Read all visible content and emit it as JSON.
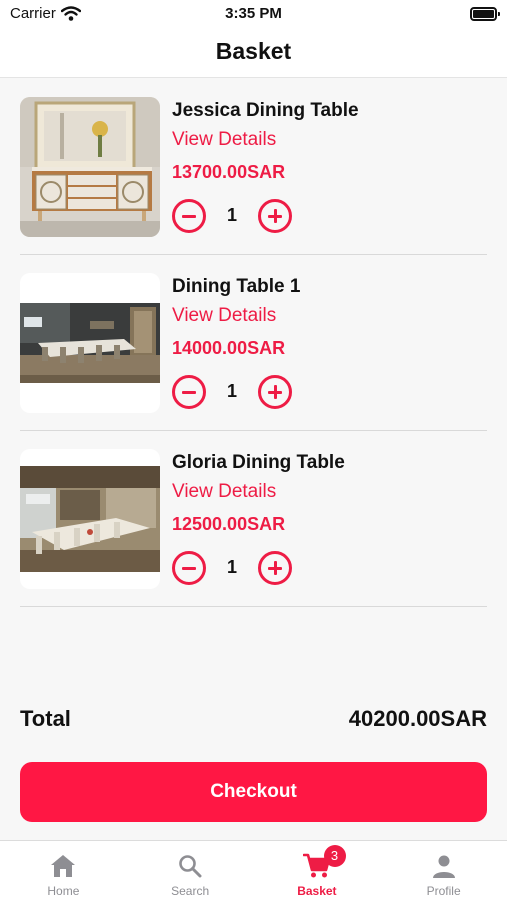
{
  "status_bar": {
    "carrier": "Carrier",
    "time": "3:35 PM"
  },
  "header": {
    "title": "Basket"
  },
  "items": [
    {
      "name": "Jessica Dining Table",
      "details_label": "View Details",
      "price": "13700.00SAR",
      "quantity": "1"
    },
    {
      "name": "Dining Table 1",
      "details_label": "View Details",
      "price": "14000.00SAR",
      "quantity": "1"
    },
    {
      "name": "Gloria Dining Table",
      "details_label": "View Details",
      "price": "12500.00SAR",
      "quantity": "1"
    }
  ],
  "summary": {
    "total_label": "Total",
    "total_value": "40200.00SAR"
  },
  "checkout": {
    "label": "Checkout"
  },
  "tabbar": {
    "tabs": [
      {
        "label": "Home",
        "icon": "home-icon"
      },
      {
        "label": "Search",
        "icon": "search-icon"
      },
      {
        "label": "Basket",
        "icon": "cart-icon",
        "badge": "3",
        "active": true
      },
      {
        "label": "Profile",
        "icon": "person-icon"
      }
    ]
  },
  "colors": {
    "accent": "#ee1c45",
    "button": "#ff1744",
    "inactive_tab": "#8e8e93"
  }
}
